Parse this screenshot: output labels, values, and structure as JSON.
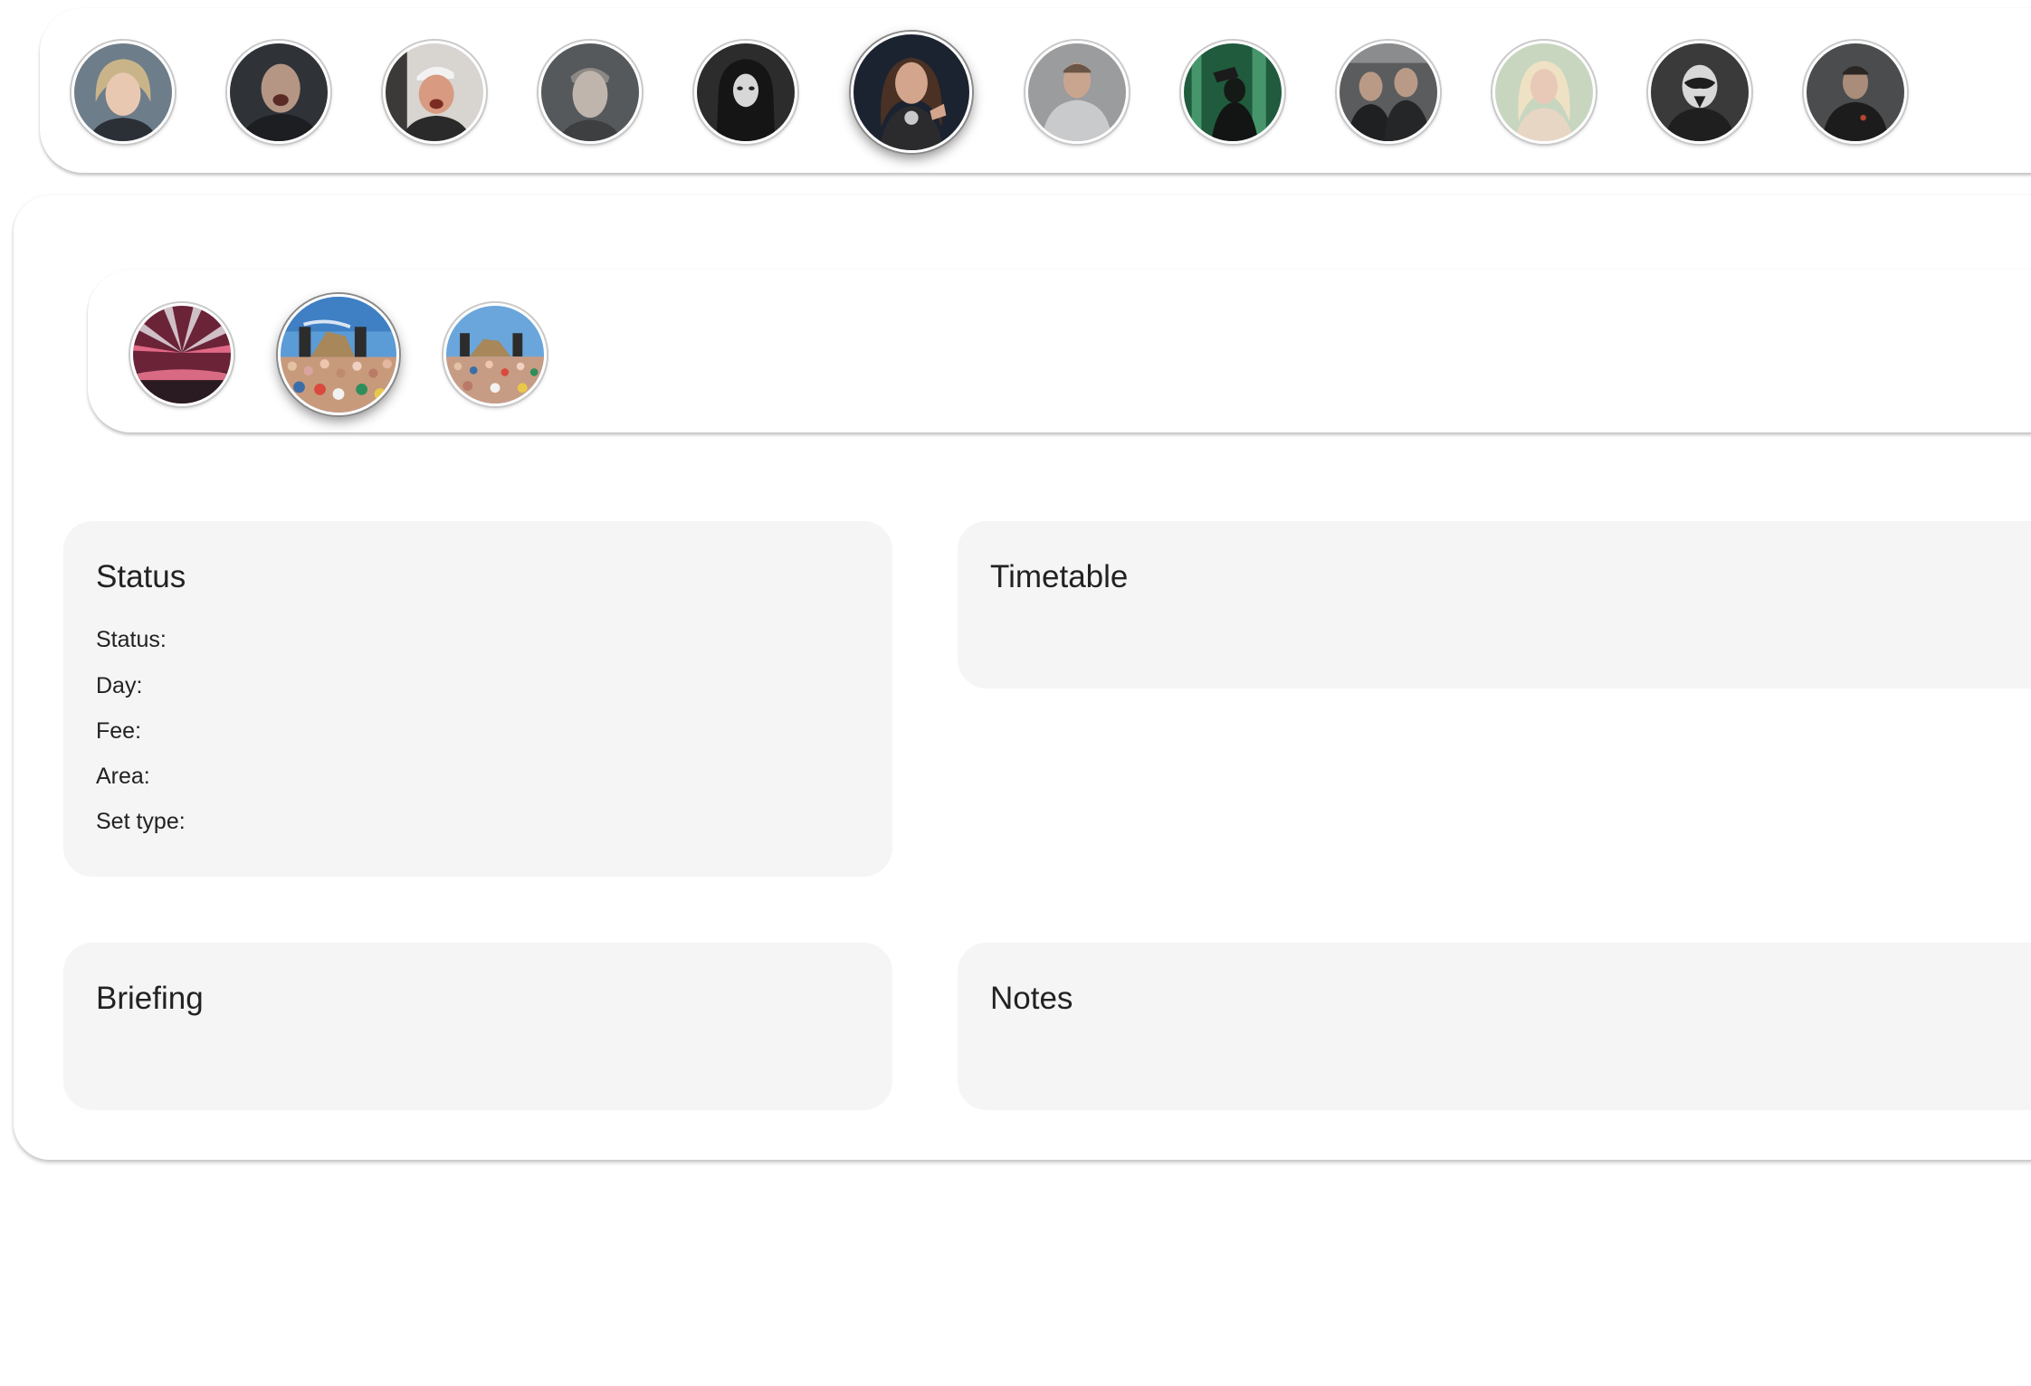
{
  "artists": [
    {
      "name_icon": "artist-avatar-1",
      "selected": false
    },
    {
      "name_icon": "artist-avatar-2",
      "selected": false
    },
    {
      "name_icon": "artist-avatar-3",
      "selected": false
    },
    {
      "name_icon": "artist-avatar-4",
      "selected": false
    },
    {
      "name_icon": "artist-avatar-5",
      "selected": false
    },
    {
      "name_icon": "artist-avatar-6",
      "selected": true
    },
    {
      "name_icon": "artist-avatar-7",
      "selected": false
    },
    {
      "name_icon": "artist-avatar-8",
      "selected": false
    },
    {
      "name_icon": "artist-avatar-9",
      "selected": false
    },
    {
      "name_icon": "artist-avatar-10",
      "selected": false
    },
    {
      "name_icon": "artist-avatar-11",
      "selected": false
    },
    {
      "name_icon": "artist-avatar-12",
      "selected": false
    }
  ],
  "stages": [
    {
      "name_icon": "stage-image-1",
      "selected": false
    },
    {
      "name_icon": "stage-image-2",
      "selected": true
    },
    {
      "name_icon": "stage-image-3",
      "selected": false
    }
  ],
  "status_panel": {
    "title": "Status",
    "fields": {
      "status": {
        "label": "Status:",
        "value": ""
      },
      "day": {
        "label": "Day:",
        "value": ""
      },
      "fee": {
        "label": "Fee:",
        "value": ""
      },
      "area": {
        "label": "Area:",
        "value": ""
      },
      "set_type": {
        "label": "Set type:",
        "value": ""
      }
    }
  },
  "timetable_panel": {
    "title": "Timetable"
  },
  "briefing_panel": {
    "title": "Briefing"
  },
  "notes_panel": {
    "title": "Notes"
  },
  "colors": {
    "background": "#ffffff",
    "panel": "#f5f5f5",
    "text": "#222222"
  }
}
